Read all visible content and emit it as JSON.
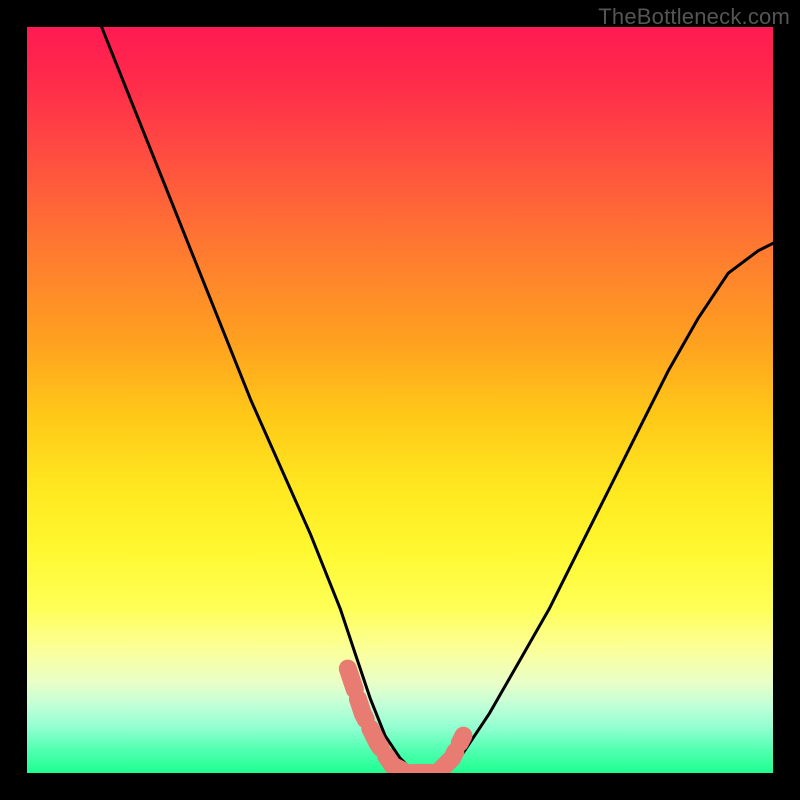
{
  "watermark": "TheBottleneck.com",
  "chart_data": {
    "type": "line",
    "title": "",
    "xlabel": "",
    "ylabel": "",
    "xlim": [
      0,
      100
    ],
    "ylim": [
      0,
      100
    ],
    "series": [
      {
        "name": "bottleneck-curve",
        "x": [
          10,
          14,
          18,
          22,
          26,
          30,
          34,
          38,
          42,
          44,
          46,
          48,
          50,
          52,
          54,
          56,
          58,
          62,
          66,
          70,
          74,
          78,
          82,
          86,
          90,
          94,
          98,
          100
        ],
        "values": [
          100,
          90,
          80,
          70,
          60,
          50,
          41,
          32,
          22,
          16,
          10,
          5,
          2,
          0,
          0,
          0,
          2,
          8,
          15,
          22,
          30,
          38,
          46,
          54,
          61,
          67,
          70,
          71
        ]
      }
    ],
    "marker_band": {
      "name": "optimal-zone",
      "x": [
        43,
        45,
        47,
        49,
        51,
        53,
        55,
        57,
        58.5
      ],
      "values": [
        14,
        8,
        4,
        1,
        0,
        0,
        0,
        2,
        5
      ]
    },
    "gradient_stops": [
      {
        "pos": 0,
        "color": "#ff1a52"
      },
      {
        "pos": 18,
        "color": "#ff5040"
      },
      {
        "pos": 42,
        "color": "#ffa020"
      },
      {
        "pos": 62,
        "color": "#ffe820"
      },
      {
        "pos": 84,
        "color": "#faffa0"
      },
      {
        "pos": 100,
        "color": "#1eff90"
      }
    ]
  }
}
